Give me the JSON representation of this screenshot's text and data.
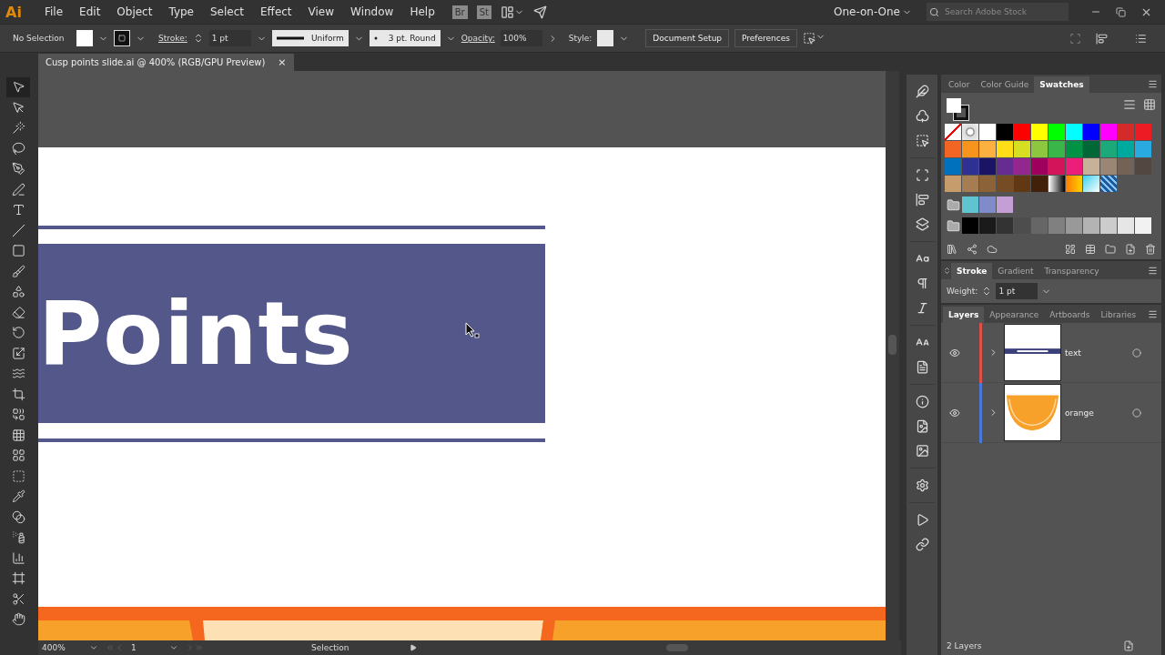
{
  "app": {
    "logo": "Ai"
  },
  "menu": [
    "File",
    "Edit",
    "Object",
    "Type",
    "Select",
    "Effect",
    "View",
    "Window",
    "Help"
  ],
  "app_switcher": [
    "Br",
    "St"
  ],
  "workspace": "One-on-One",
  "search": {
    "placeholder": "Search Adobe Stock"
  },
  "control_bar": {
    "selection": "No Selection",
    "stroke_label": "Stroke:",
    "stroke_weight": "1 pt",
    "profile": "Uniform",
    "brush": "3 pt. Round",
    "opacity_label": "Opacity:",
    "opacity": "100%",
    "style_label": "Style:",
    "buttons": [
      "Document Setup",
      "Preferences"
    ]
  },
  "document_tabs": [
    {
      "title": "Cusp points slide.ai @ 400% (RGB/GPU Preview)",
      "selected": true,
      "close": "×"
    }
  ],
  "tools": [
    {
      "kind": "selection",
      "selected": true
    },
    {
      "kind": "direct",
      "selected": false
    },
    {
      "kind": "wand",
      "selected": false
    },
    {
      "kind": "lasso",
      "selected": false
    },
    {
      "kind": "pen",
      "selected": false
    },
    {
      "kind": "curvature",
      "selected": false
    },
    {
      "kind": "type",
      "selected": false
    },
    {
      "kind": "line",
      "selected": false
    },
    {
      "kind": "rectangle",
      "selected": false
    },
    {
      "kind": "brush",
      "selected": false
    },
    {
      "kind": "shaper",
      "selected": false
    },
    {
      "kind": "eraser",
      "selected": false
    },
    {
      "kind": "rotate",
      "selected": false
    },
    {
      "kind": "scale",
      "selected": false
    },
    {
      "kind": "warp",
      "selected": false
    },
    {
      "kind": "transform",
      "selected": false
    },
    {
      "kind": "builder",
      "selected": false
    },
    {
      "kind": "perspective",
      "selected": false
    },
    {
      "kind": "mesh",
      "selected": false
    },
    {
      "kind": "gradient",
      "selected": false
    },
    {
      "kind": "eyedropper",
      "selected": false
    },
    {
      "kind": "blend",
      "selected": false
    },
    {
      "kind": "sprayer",
      "selected": false
    },
    {
      "kind": "graph",
      "selected": false
    },
    {
      "kind": "artboard",
      "selected": false
    },
    {
      "kind": "slice",
      "selected": false
    },
    {
      "kind": "hand",
      "selected": false
    }
  ],
  "artboard": {
    "heading": "Points"
  },
  "status_bar": {
    "zoom": "400%",
    "artboard": "1",
    "tool": "Selection"
  },
  "swatch_panel": {
    "tabs": [
      {
        "label": "Color",
        "selected": false
      },
      {
        "label": "Color Guide",
        "selected": false
      },
      {
        "label": "Swatches",
        "selected": true
      }
    ],
    "groups": [
      {
        "kind": "main",
        "swatches": [
          {
            "kind": "none"
          },
          {
            "kind": "registration"
          },
          {
            "kind": "color",
            "color": "#ffffff"
          },
          {
            "kind": "color",
            "color": "#000000"
          },
          {
            "kind": "color",
            "color": "#ff0000"
          },
          {
            "kind": "color",
            "color": "#ffff00"
          },
          {
            "kind": "color",
            "color": "#00ff00"
          },
          {
            "kind": "color",
            "color": "#00ffff"
          },
          {
            "kind": "color",
            "color": "#0000ff"
          },
          {
            "kind": "color",
            "color": "#ff00ff"
          },
          {
            "kind": "color",
            "color": "#d42a2a"
          },
          {
            "kind": "color",
            "color": "#ed1c24"
          },
          {
            "kind": "color",
            "color": "#f26522"
          },
          {
            "kind": "color",
            "color": "#f7941d"
          },
          {
            "kind": "color",
            "color": "#fbb040"
          },
          {
            "kind": "color",
            "color": "#ffde17"
          },
          {
            "kind": "color",
            "color": "#d7df23"
          },
          {
            "kind": "color",
            "color": "#8dc63f"
          },
          {
            "kind": "color",
            "color": "#39b54a"
          },
          {
            "kind": "color",
            "color": "#009245"
          },
          {
            "kind": "color",
            "color": "#006837"
          },
          {
            "kind": "color",
            "color": "#1ba97a"
          },
          {
            "kind": "color",
            "color": "#00a99d"
          },
          {
            "kind": "color",
            "color": "#29abe2"
          },
          {
            "kind": "color",
            "color": "#0071bc"
          },
          {
            "kind": "color",
            "color": "#2e3192"
          },
          {
            "kind": "color",
            "color": "#1b1464"
          },
          {
            "kind": "color",
            "color": "#662d91"
          },
          {
            "kind": "color",
            "color": "#93278f"
          },
          {
            "kind": "color",
            "color": "#9e005d"
          },
          {
            "kind": "color",
            "color": "#d4145a"
          },
          {
            "kind": "color",
            "color": "#ed1e79"
          },
          {
            "kind": "color",
            "color": "#c7b299"
          },
          {
            "kind": "color",
            "color": "#998675"
          },
          {
            "kind": "color",
            "color": "#736357"
          },
          {
            "kind": "color",
            "color": "#534741"
          },
          {
            "kind": "color",
            "color": "#c69c6d"
          },
          {
            "kind": "color",
            "color": "#a67c52"
          },
          {
            "kind": "color",
            "color": "#8c6239"
          },
          {
            "kind": "color",
            "color": "#754c24"
          },
          {
            "kind": "color",
            "color": "#603813"
          },
          {
            "kind": "color",
            "color": "#42210b"
          },
          {
            "kind": "gradient"
          },
          {
            "kind": "gradient-warm"
          },
          {
            "kind": "gradient-cool"
          },
          {
            "kind": "pattern"
          }
        ]
      },
      {
        "kind": "folder",
        "swatches": [
          {
            "kind": "color",
            "color": "#5fc4d0"
          },
          {
            "kind": "color",
            "color": "#7f8cc9"
          },
          {
            "kind": "color",
            "color": "#c39fd6"
          }
        ]
      },
      {
        "kind": "folder",
        "swatches": [
          {
            "kind": "color",
            "color": "#000000"
          },
          {
            "kind": "color",
            "color": "#1a1a1a"
          },
          {
            "kind": "color",
            "color": "#333333"
          },
          {
            "kind": "color",
            "color": "#4d4d4d"
          },
          {
            "kind": "color",
            "color": "#666666"
          },
          {
            "kind": "color",
            "color": "#808080"
          },
          {
            "kind": "color",
            "color": "#999999"
          },
          {
            "kind": "color",
            "color": "#b3b3b3"
          },
          {
            "kind": "color",
            "color": "#cccccc"
          },
          {
            "kind": "color",
            "color": "#e6e6e6"
          },
          {
            "kind": "color",
            "color": "#f2f2f2"
          }
        ]
      }
    ]
  },
  "stroke_panel": {
    "tabs": [
      {
        "label": "Stroke",
        "selected": true
      },
      {
        "label": "Gradient",
        "selected": false
      },
      {
        "label": "Transparency",
        "selected": false
      }
    ],
    "weight_label": "Weight:",
    "weight": "1 pt"
  },
  "layers_panel": {
    "tabs": [
      {
        "label": "Layers",
        "selected": true
      },
      {
        "label": "Appearance",
        "selected": false
      },
      {
        "label": "Artboards",
        "selected": false
      },
      {
        "label": "Libraries",
        "selected": false
      }
    ],
    "layers": [
      {
        "name": "text",
        "visible": true,
        "expanded": false,
        "color": "#e0504a",
        "kind": "text"
      },
      {
        "name": "orange",
        "visible": true,
        "expanded": false,
        "color": "#4a78d8",
        "kind": "orange"
      }
    ],
    "footer": "2 Layers"
  }
}
